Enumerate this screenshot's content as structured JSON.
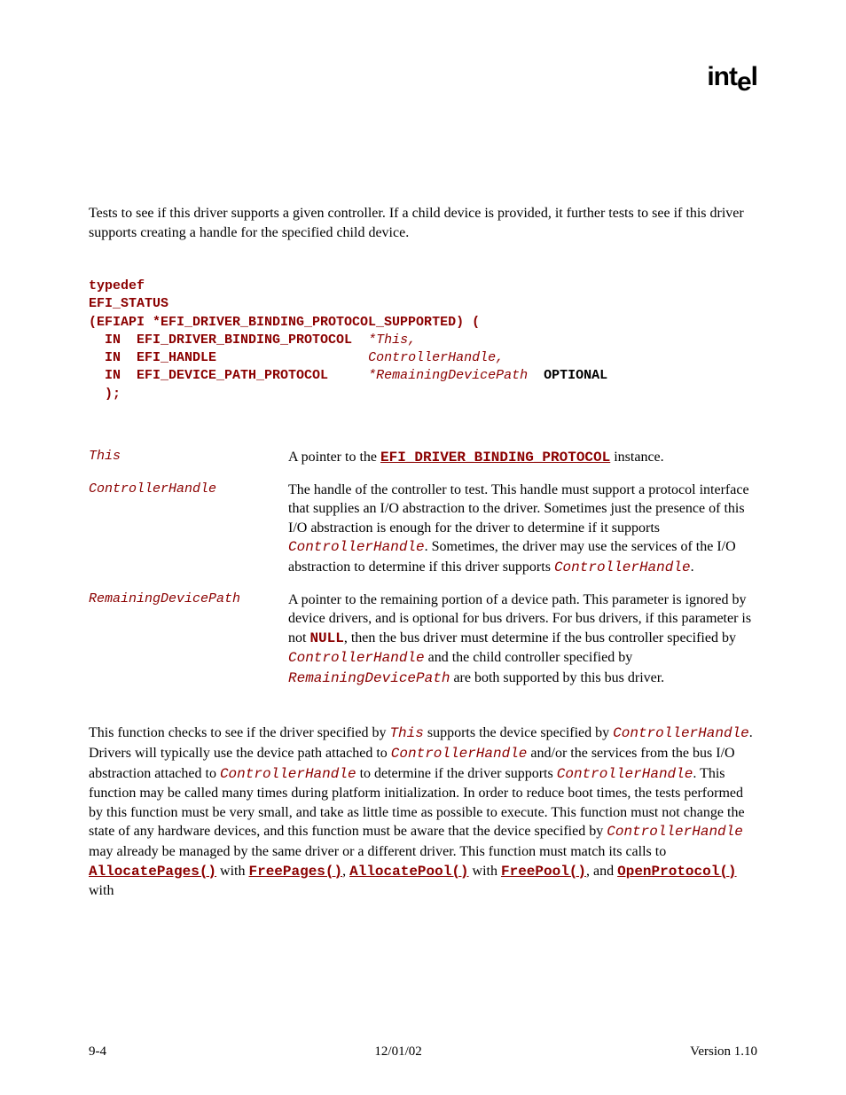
{
  "logo": "intel",
  "intro_text": "Tests to see if this driver supports a given controller.  If a child device is provided, it further tests to see if this driver supports creating a handle for the specified child device.",
  "proto": {
    "l1a": "typedef",
    "l2a": "EFI_STATUS",
    "l3a": "(EFIAPI *EFI_DRIVER_BINDING_PROTOCOL_SUPPORTED) (",
    "l4a": "  IN  EFI_DRIVER_BINDING_PROTOCOL  ",
    "l4b": "*This,",
    "l5a": "  IN  EFI_HANDLE                   ",
    "l5b": "ControllerHandle,",
    "l6a": "  IN  EFI_DEVICE_PATH_PROTOCOL     ",
    "l6b": "*RemainingDevicePath",
    "l6c": "  OPTIONAL",
    "l7a": "  );"
  },
  "params": {
    "p1_name": "This",
    "p1_t1": "A pointer to the ",
    "p1_code": "EFI_DRIVER_BINDING_PROTOCOL",
    "p1_t2": " instance.",
    "p2_name": "ControllerHandle",
    "p2_t1": "The handle of the controller to test.  This handle must support a protocol interface that supplies an I/O abstraction to the driver.  Sometimes just the presence of this I/O abstraction is enough for the driver to determine if it supports ",
    "p2_c1": "ControllerHandle",
    "p2_t2": ".  Sometimes, the driver may use the services of the I/O abstraction to determine if this driver supports ",
    "p2_c2": "ControllerHandle",
    "p2_t3": ".",
    "p3_name": "RemainingDevicePath",
    "p3_t1": "A pointer to the remaining portion of a device path.  This parameter is ignored by device drivers, and is optional for bus drivers.  For bus drivers, if this parameter is not ",
    "p3_c1": "NULL",
    "p3_t2": ", then the bus driver must determine if the bus controller specified by ",
    "p3_c2": "ControllerHandle",
    "p3_t3": " and the child controller specified by ",
    "p3_c3": "RemainingDevicePath",
    "p3_t4": " are both supported by this bus driver."
  },
  "desc": {
    "t1": "This function checks to see if the driver specified by ",
    "c1": "This",
    "t2": " supports the device specified by ",
    "c2": "ControllerHandle",
    "t3": ".  Drivers will typically use the device path attached to ",
    "c3": "ControllerHandle",
    "t4": " and/or the services from the bus I/O abstraction attached to ",
    "c4": "ControllerHandle",
    "t5": " to determine if the driver supports ",
    "c5": "ControllerHandle",
    "t6": ".  This function may be called many times during platform initialization.  In order to reduce boot times, the tests performed by this function must be very small, and take as little time as possible to execute.  This function must not change the state of any hardware devices, and this function must be aware that the device specified by ",
    "c6": "ControllerHandle",
    "t7": " may already be managed by the same driver or a different driver.  This function must match its calls to ",
    "l1": "AllocatePages()",
    "t8": " with ",
    "l2": "FreePages()",
    "t9": ", ",
    "l3": "AllocatePool()",
    "t10": " with ",
    "l4": "FreePool()",
    "t11": ", and ",
    "l5": "OpenProtocol()",
    "t12": " with"
  },
  "footer": {
    "left": "9-4",
    "center": "12/01/02",
    "right": "Version 1.10"
  }
}
